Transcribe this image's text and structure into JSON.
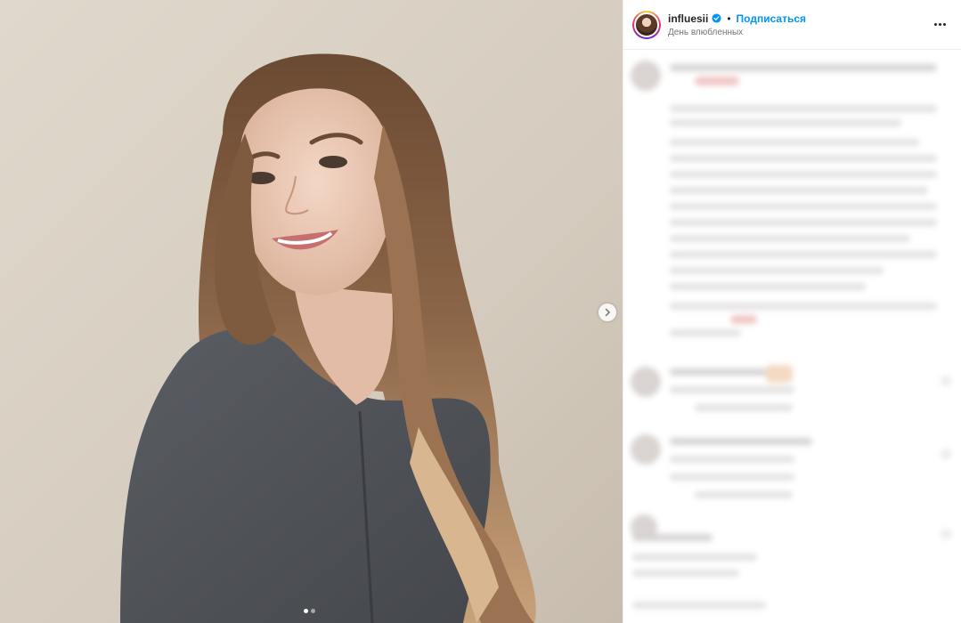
{
  "post": {
    "username": "influesii",
    "separator": "•",
    "follow_label": "Подписаться",
    "subtitle": "День влюбленных"
  },
  "carousel": {
    "total_slides": 2,
    "active_slide": 1
  },
  "icons": {
    "verified": "verified-badge-icon",
    "more": "more-options-icon",
    "next": "chevron-right-icon"
  },
  "colors": {
    "link_blue": "#0095f6",
    "verified_blue": "#0095f6",
    "text": "#262626",
    "muted": "#737373"
  }
}
